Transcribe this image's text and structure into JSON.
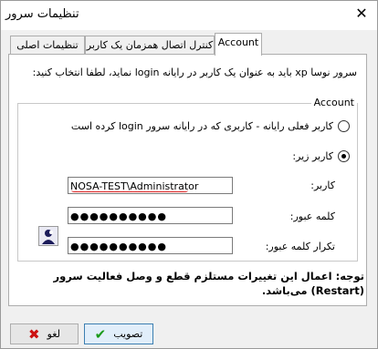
{
  "window": {
    "title": "تنظیمات سرور",
    "close_glyph": "✕"
  },
  "tabs": [
    {
      "label": "تنظیمات اصلی"
    },
    {
      "label": "کنترل اتصال همزمان یک کاربر"
    },
    {
      "label": "Account"
    }
  ],
  "account": {
    "description": "سرور نوسا xp باید به عنوان یک کاربر در رایانه login نماید، لطفا انتخاب کنید:",
    "group_title": "Account",
    "option_current": "کاربر فعلی رایانه - کاربری که در رایانه سرور login کرده است",
    "option_below": "کاربر زیر:",
    "user_label": "کاربر:",
    "user_value": "NOSA-TEST\\Administrator",
    "password_label": "کلمه عبور:",
    "password_value": "●●●●●●●●●●",
    "confirm_label": "تکرار کلمه عبور:",
    "confirm_value": "●●●●●●●●●●"
  },
  "note": "توجه: اعمال این تغییرات مستلزم قطع و وصل فعالیت سرور (Restart) می‌باشد.",
  "buttons": {
    "cancel_label": "لغو",
    "cancel_icon": "✖",
    "ok_label": "تصویب",
    "ok_icon": "✔"
  },
  "colors": {
    "cancel_icon": "#cc1111",
    "ok_icon": "#1a9a1a",
    "focus_border": "#3c7fb1"
  }
}
